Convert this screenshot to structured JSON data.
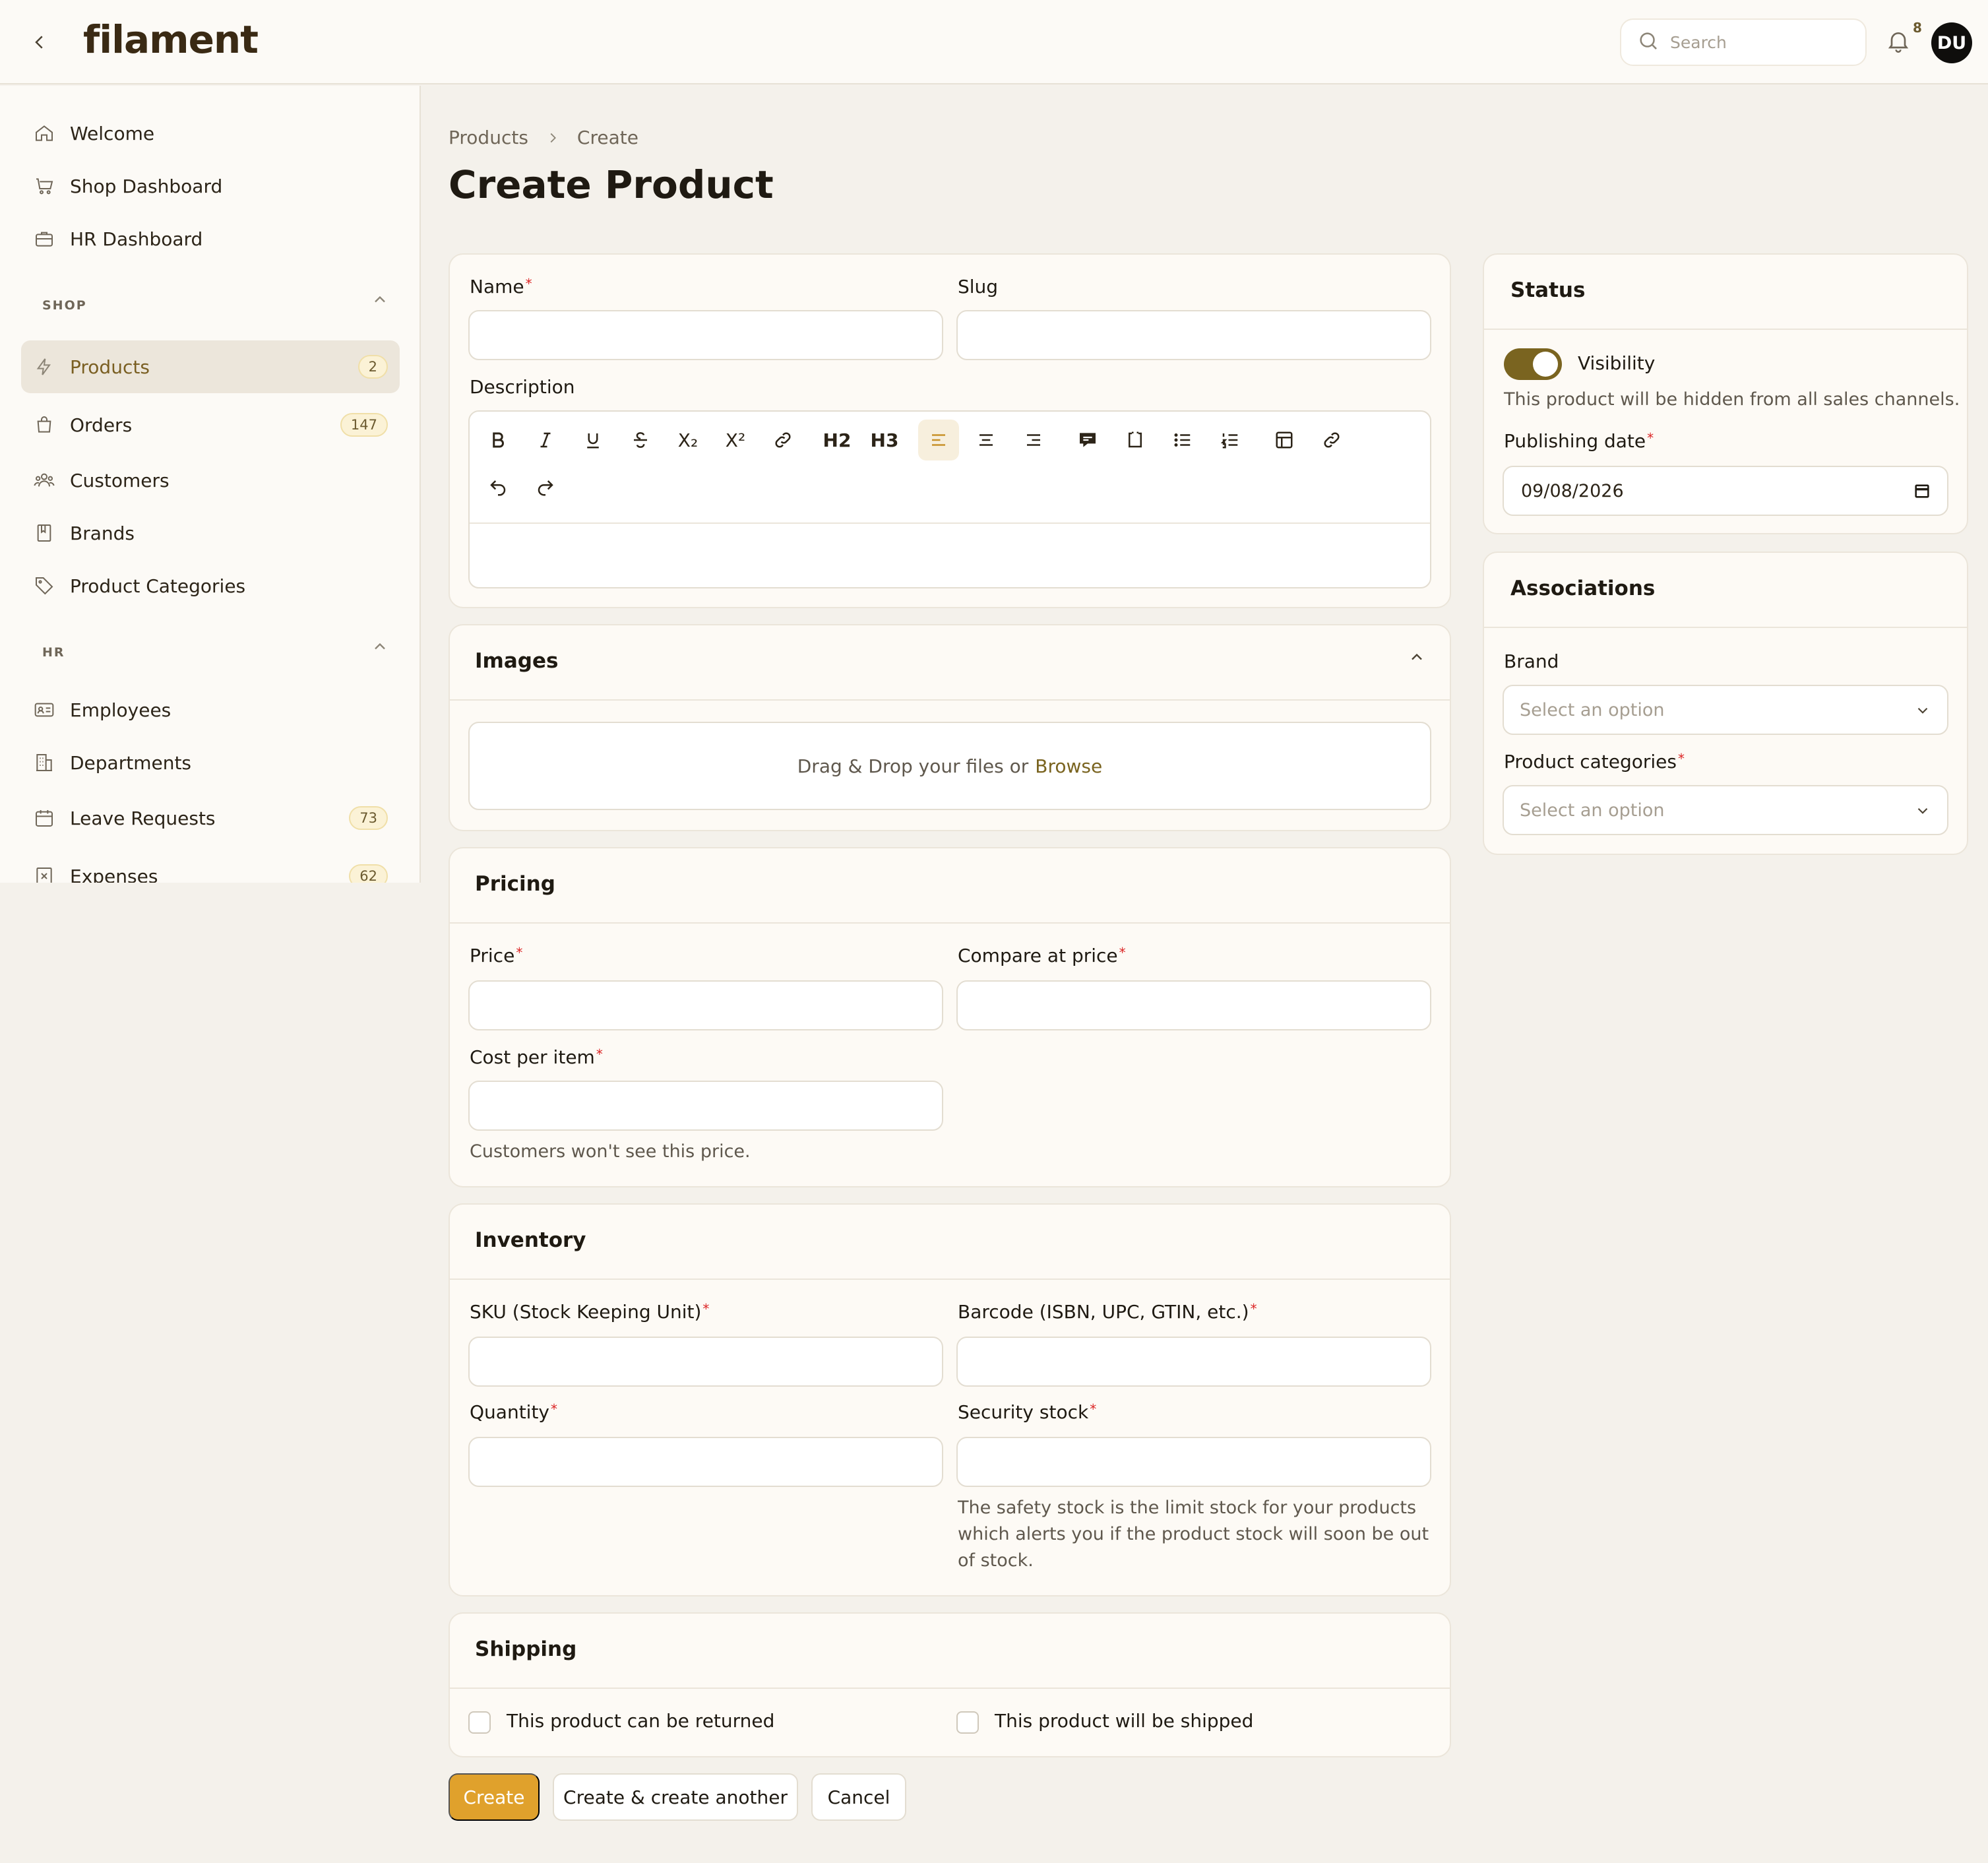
{
  "topbar": {
    "logo": "filament",
    "search_placeholder": "Search",
    "notification_count": "8",
    "avatar_initials": "DU"
  },
  "sidebar": {
    "top_items": [
      {
        "label": "Welcome",
        "icon": "home-icon"
      },
      {
        "label": "Shop Dashboard",
        "icon": "cart-icon"
      },
      {
        "label": "HR Dashboard",
        "icon": "briefcase-icon"
      }
    ],
    "groups": [
      {
        "label": "SHOP",
        "items": [
          {
            "label": "Products",
            "icon": "bolt-icon",
            "badge": "2",
            "active": true
          },
          {
            "label": "Orders",
            "icon": "bag-icon",
            "badge": "147"
          },
          {
            "label": "Customers",
            "icon": "users-icon"
          },
          {
            "label": "Brands",
            "icon": "book-icon"
          },
          {
            "label": "Product Categories",
            "icon": "tag-icon"
          }
        ]
      },
      {
        "label": "HR",
        "items": [
          {
            "label": "Employees",
            "icon": "id-card-icon"
          },
          {
            "label": "Departments",
            "icon": "building-icon"
          },
          {
            "label": "Leave Requests",
            "icon": "calendar-icon",
            "badge": "73"
          },
          {
            "label": "Expenses",
            "icon": "receipt-icon",
            "badge": "62"
          }
        ]
      }
    ]
  },
  "breadcrumb": [
    "Products",
    "Create"
  ],
  "page_title": "Create Product",
  "main_form": {
    "name_label": "Name",
    "slug_label": "Slug",
    "description_label": "Description",
    "toolbar": {
      "h2": "H2",
      "h3": "H3",
      "subscript": "X₂",
      "superscript": "X²"
    }
  },
  "images": {
    "title": "Images",
    "drop_text": "Drag & Drop your files or",
    "browse": "Browse"
  },
  "pricing": {
    "title": "Pricing",
    "price_label": "Price",
    "compare_label": "Compare at price",
    "cost_label": "Cost per item",
    "cost_hint": "Customers won't see this price."
  },
  "inventory": {
    "title": "Inventory",
    "sku_label": "SKU (Stock Keeping Unit)",
    "barcode_label": "Barcode (ISBN, UPC, GTIN, etc.)",
    "quantity_label": "Quantity",
    "security_label": "Security stock",
    "security_hint_1": "The safety stock is the limit stock for your products",
    "security_hint_2": "which alerts you if the product stock will soon be out",
    "security_hint_3": "of stock."
  },
  "shipping": {
    "title": "Shipping",
    "returned_label": "This product can be returned",
    "shipped_label": "This product will be shipped"
  },
  "status": {
    "title": "Status",
    "visibility_label": "Visibility",
    "visibility_on": true,
    "visibility_hint": "This product will be hidden from all sales channels.",
    "publishing_label": "Publishing date",
    "publishing_value": "09/08/2026"
  },
  "associations": {
    "title": "Associations",
    "brand_label": "Brand",
    "brand_placeholder": "Select an option",
    "categories_label": "Product categories",
    "categories_placeholder": "Select an option"
  },
  "actions": {
    "create": "Create",
    "create_another": "Create & create another",
    "cancel": "Cancel"
  },
  "colors": {
    "accent": "#e0a12c",
    "brand_dark": "#7a6420",
    "required": "#dc2626"
  }
}
